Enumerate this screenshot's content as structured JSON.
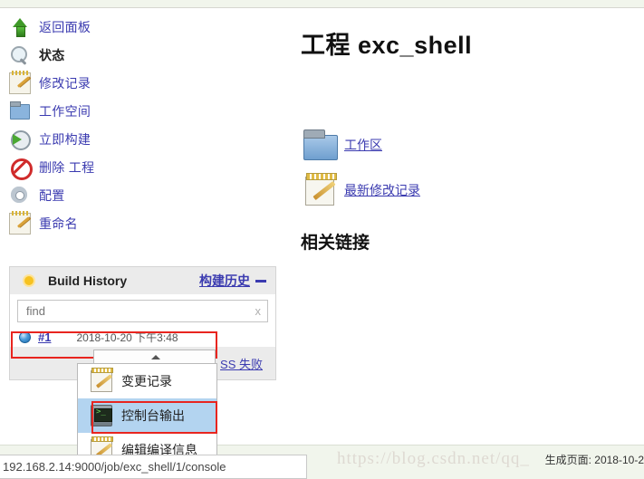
{
  "sidebar": {
    "items": [
      {
        "label": "返回面板",
        "icon": "arrow-up-icon",
        "bold": false
      },
      {
        "label": "状态",
        "icon": "search-icon",
        "bold": true
      },
      {
        "label": "修改记录",
        "icon": "notepad-pencil-icon",
        "bold": false
      },
      {
        "label": "工作空间",
        "icon": "folder-icon",
        "bold": false
      },
      {
        "label": "立即构建",
        "icon": "build-now-clock-icon",
        "bold": false
      },
      {
        "label": "删除 工程",
        "icon": "delete-forbidden-icon",
        "bold": false
      },
      {
        "label": "配置",
        "icon": "gear-icon",
        "bold": false
      },
      {
        "label": "重命名",
        "icon": "notepad-pencil-icon",
        "bold": false
      }
    ]
  },
  "main": {
    "page_title": "工程 exc_shell",
    "links": [
      {
        "label": "工作区",
        "icon": "folder-large-icon"
      },
      {
        "label": "最新修改记录",
        "icon": "notepad-large-icon"
      }
    ],
    "section_title": "相关链接"
  },
  "build_history": {
    "title": "Build History",
    "title_cn": "构建历史",
    "collapse_icon": "minus-icon",
    "weather_icon": "sun-icon",
    "find": {
      "value": "find",
      "placeholder": "find",
      "clear_label": "x"
    },
    "build": {
      "status_icon": "blue-ball-icon",
      "number": "#1",
      "date": "2018-10-20 下午3:48"
    },
    "rss_label": "SS 失败"
  },
  "dropdown": {
    "caret_icon": "caret-up-icon",
    "items": [
      {
        "label": "变更记录",
        "icon": "notepad-pencil-icon",
        "selected": false
      },
      {
        "label": "控制台输出",
        "icon": "console-icon",
        "selected": true
      },
      {
        "label": "编辑编译信息",
        "icon": "notepad-pencil-icon",
        "selected": false
      }
    ]
  },
  "status_bar": {
    "url": "192.168.2.14:9000/job/exc_shell/1/console"
  },
  "footer": {
    "watermark": "https://blog.csdn.net/qq_",
    "generated": "生成页面: 2018-10-2"
  },
  "colors": {
    "link": "#3b3bb0",
    "highlight_red": "#e8251f",
    "selection_blue": "#b3d4f0",
    "panel_gray": "#ebebeb",
    "strip_green": "#f1f5ec"
  }
}
